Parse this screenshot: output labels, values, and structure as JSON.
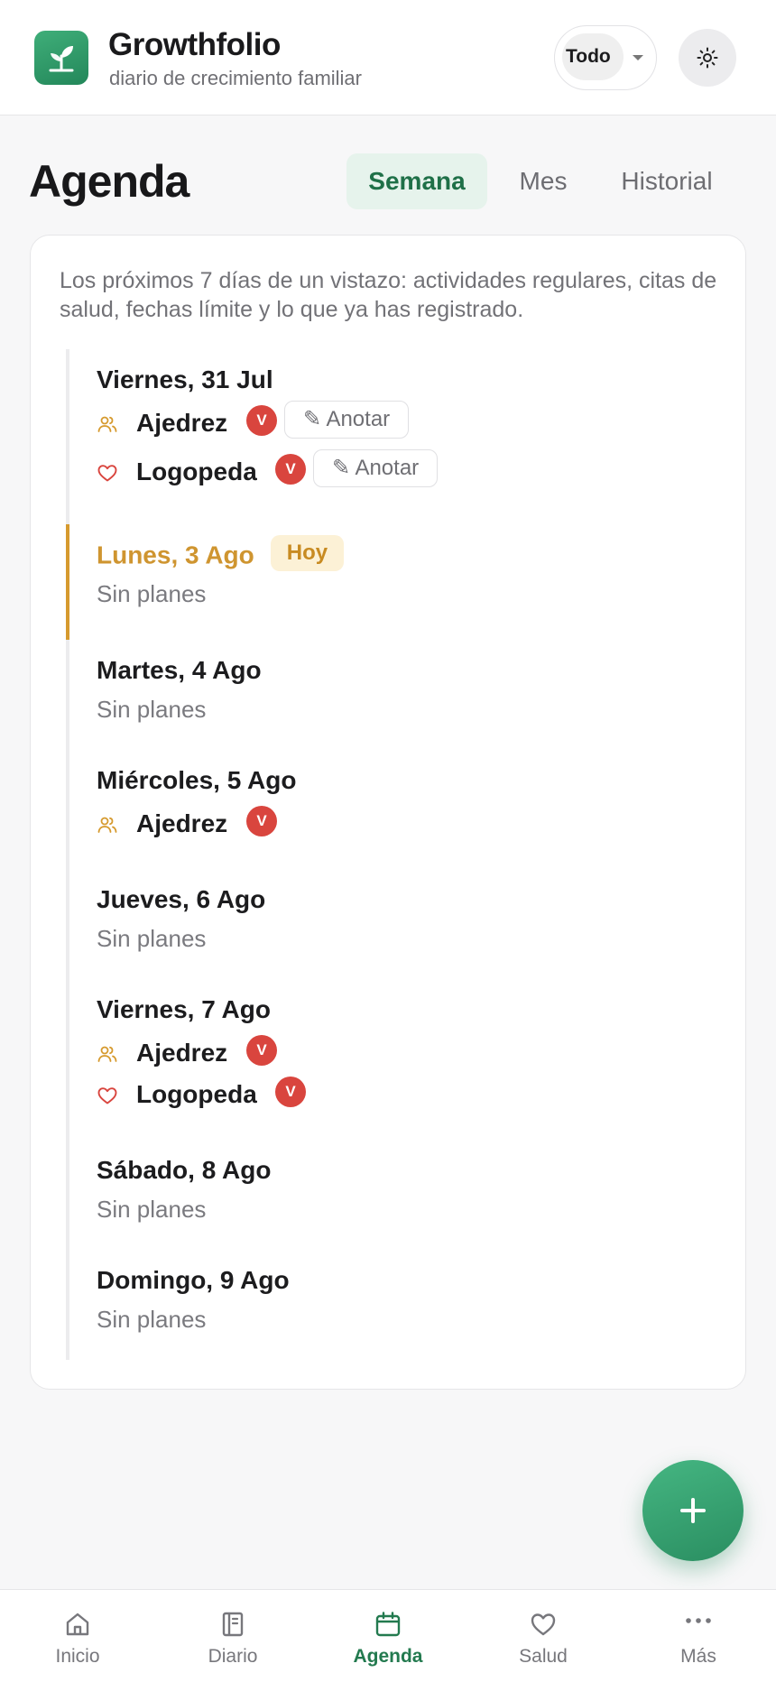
{
  "app": {
    "title": "Growthfolio",
    "subtitle": "diario de crecimiento familiar",
    "filter_value": "Todo"
  },
  "page": {
    "title": "Agenda",
    "tabs": [
      {
        "label": "Semana",
        "active": true
      },
      {
        "label": "Mes",
        "active": false
      },
      {
        "label": "Historial",
        "active": false
      }
    ],
    "intro": "Los próximos 7 días de un vistazo: actividades regulares, citas de salud, fechas límite y lo que ya has registrado."
  },
  "days": [
    {
      "title": "Viernes, 31 Jul",
      "events": [
        {
          "icon": "people-icon",
          "name": "Ajedrez",
          "badge": "V",
          "note_label": "✎ Anotar"
        },
        {
          "icon": "heart-icon",
          "name": "Logopeda",
          "badge": "V",
          "note_label": "✎ Anotar"
        }
      ]
    },
    {
      "title": "Lunes, 3 Ago",
      "today": true,
      "today_badge": "Hoy",
      "empty": "Sin planes"
    },
    {
      "title": "Martes, 4 Ago",
      "empty": "Sin planes"
    },
    {
      "title": "Miércoles, 5 Ago",
      "events": [
        {
          "icon": "people-icon",
          "name": "Ajedrez",
          "badge": "V"
        }
      ]
    },
    {
      "title": "Jueves, 6 Ago",
      "empty": "Sin planes"
    },
    {
      "title": "Viernes, 7 Ago",
      "events": [
        {
          "icon": "people-icon",
          "name": "Ajedrez",
          "badge": "V"
        },
        {
          "icon": "heart-icon",
          "name": "Logopeda",
          "badge": "V"
        }
      ]
    },
    {
      "title": "Sábado, 8 Ago",
      "empty": "Sin planes"
    },
    {
      "title": "Domingo, 9 Ago",
      "empty": "Sin planes"
    }
  ],
  "fab": {
    "icon": "plus-icon"
  },
  "nav": [
    {
      "label": "Inicio",
      "icon": "home-icon",
      "active": false
    },
    {
      "label": "Diario",
      "icon": "journal-icon",
      "active": false
    },
    {
      "label": "Agenda",
      "icon": "calendar-icon",
      "active": true
    },
    {
      "label": "Salud",
      "icon": "heart-icon",
      "active": false
    },
    {
      "label": "Más",
      "icon": "more-icon",
      "active": false
    }
  ],
  "colors": {
    "brand": "#2a8e61",
    "today": "#cf9530",
    "badge": "#d9453e",
    "activity_icon": "#d69a2e",
    "health_icon": "#d9453e"
  }
}
